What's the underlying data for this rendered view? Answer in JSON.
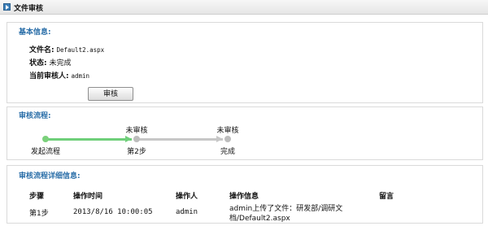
{
  "header": {
    "title": "文件审核"
  },
  "basic_info": {
    "section_title": "基本信息:",
    "filename_label": "文件名:",
    "filename_value": "Default2.aspx",
    "status_label": "状态:",
    "status_value": "未完成",
    "reviewer_label": "当前审核人:",
    "reviewer_value": "admin",
    "review_button": "审核"
  },
  "flow": {
    "section_title": "审核流程:",
    "steps": [
      {
        "top": "",
        "bottom": "发起流程",
        "color": "#7bd17b"
      },
      {
        "top": "未审核",
        "bottom": "第2步",
        "color": "#bdbdbd"
      },
      {
        "top": "未审核",
        "bottom": "完成",
        "color": "#bdbdbd"
      }
    ],
    "done_color": "#6fcf7a",
    "pending_color": "#c7c7c7"
  },
  "detail": {
    "section_title": "审核流程详细信息:",
    "headers": [
      "步骤",
      "操作时间",
      "操作人",
      "操作信息",
      "留言"
    ],
    "rows": [
      {
        "step": "第1步",
        "time": "2013/8/16 10:00:05",
        "operator": "admin",
        "info_line1": "admin上传了文件：研发部/调研文",
        "info_line2": "档/Default2.aspx",
        "message": ""
      }
    ]
  }
}
